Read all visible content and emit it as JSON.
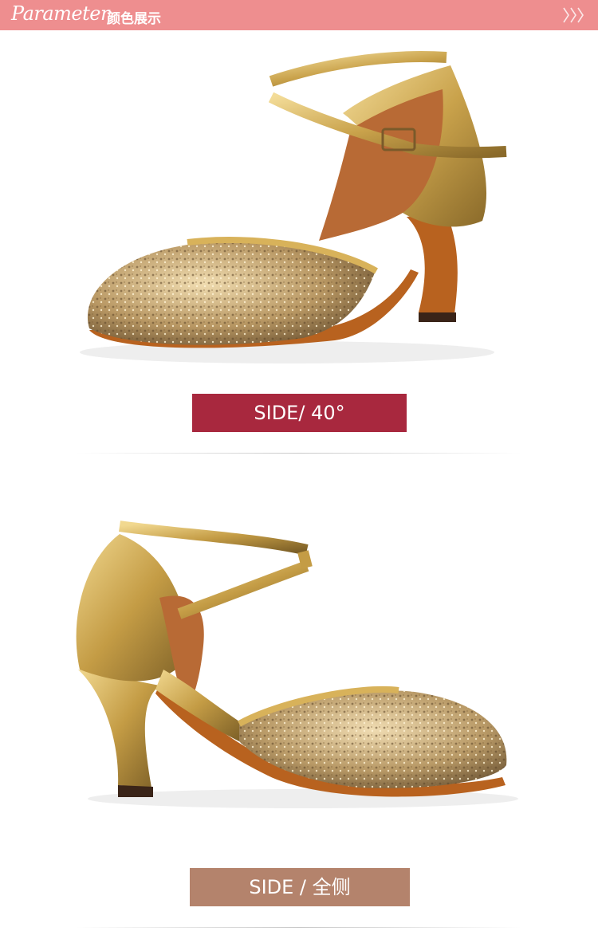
{
  "header": {
    "script_title": "Parameter",
    "cn_title": "颜色展示"
  },
  "images": [
    {
      "name": "gold-glitter-dance-shoe-side-40"
    },
    {
      "name": "gold-glitter-dance-shoe-full-side"
    }
  ],
  "labels": {
    "first": "SIDE/ 40°",
    "second": "SIDE / 全侧"
  },
  "colors": {
    "header_bg": "#ee8e8f",
    "label1_bg": "#a8283e",
    "label2_bg": "#b4836c",
    "gold": "#c9a24b"
  }
}
